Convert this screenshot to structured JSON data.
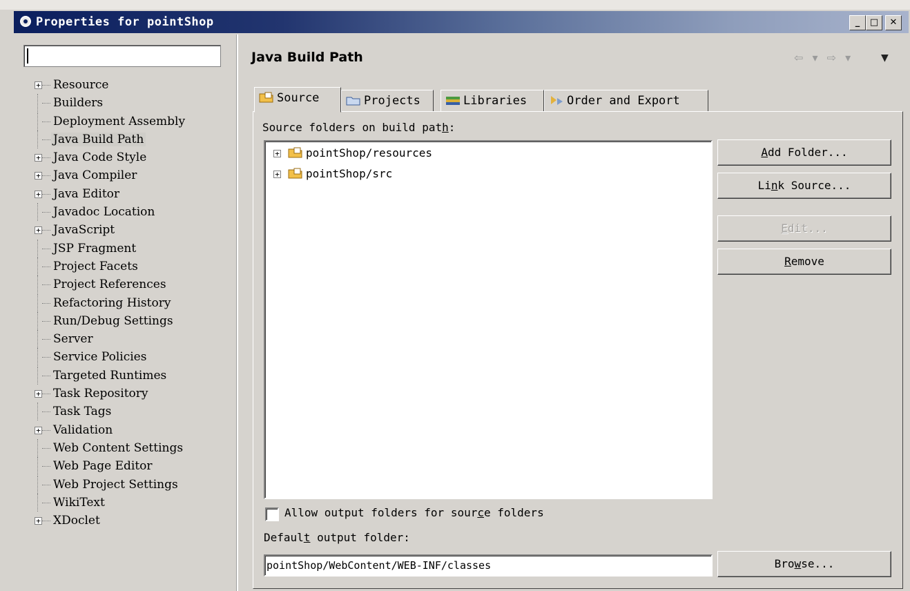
{
  "window": {
    "title": "Properties for pointShop",
    "minimize_label": "_",
    "maximize_label": "□",
    "close_label": "✕"
  },
  "filter": {
    "value": ""
  },
  "tree": [
    {
      "label": "Resource",
      "expandable": true
    },
    {
      "label": "Builders",
      "expandable": false
    },
    {
      "label": "Deployment Assembly",
      "expandable": false
    },
    {
      "label": "Java Build Path",
      "expandable": false,
      "selected": true
    },
    {
      "label": "Java Code Style",
      "expandable": true
    },
    {
      "label": "Java Compiler",
      "expandable": true
    },
    {
      "label": "Java Editor",
      "expandable": true
    },
    {
      "label": "Javadoc Location",
      "expandable": false
    },
    {
      "label": "JavaScript",
      "expandable": true
    },
    {
      "label": "JSP Fragment",
      "expandable": false
    },
    {
      "label": "Project Facets",
      "expandable": false
    },
    {
      "label": "Project References",
      "expandable": false
    },
    {
      "label": "Refactoring History",
      "expandable": false
    },
    {
      "label": "Run/Debug Settings",
      "expandable": false
    },
    {
      "label": "Server",
      "expandable": false
    },
    {
      "label": "Service Policies",
      "expandable": false
    },
    {
      "label": "Targeted Runtimes",
      "expandable": false
    },
    {
      "label": "Task Repository",
      "expandable": true
    },
    {
      "label": "Task Tags",
      "expandable": false
    },
    {
      "label": "Validation",
      "expandable": true
    },
    {
      "label": "Web Content Settings",
      "expandable": false
    },
    {
      "label": "Web Page Editor",
      "expandable": false
    },
    {
      "label": "Web Project Settings",
      "expandable": false
    },
    {
      "label": "WikiText",
      "expandable": false
    },
    {
      "label": "XDoclet",
      "expandable": true
    }
  ],
  "page": {
    "title": "Java Build Path",
    "nav_back": "⇦ ▾",
    "nav_forward": "⇨ ▾",
    "menu": "▼"
  },
  "tabs": [
    {
      "label": "Source",
      "icon": "source-folder-icon",
      "active": true
    },
    {
      "label": "Projects",
      "icon": "projects-icon"
    },
    {
      "label": "Libraries",
      "icon": "libraries-icon"
    },
    {
      "label": "Order and Export",
      "icon": "order-export-icon"
    }
  ],
  "source": {
    "label_pre": "Source folders on build pat",
    "label_mnemonic": "h",
    "label_post": ":",
    "folders": [
      "pointShop/resources",
      "pointShop/src"
    ]
  },
  "buttons": {
    "add_folder": {
      "pre": "",
      "mn": "A",
      "post": "dd Folder..."
    },
    "link_source": {
      "pre": "Li",
      "mn": "n",
      "post": "k Source..."
    },
    "edit": {
      "pre": "",
      "mn": "E",
      "post": "dit..."
    },
    "remove": {
      "pre": "",
      "mn": "R",
      "post": "emove"
    },
    "browse": {
      "pre": "Bro",
      "mn": "w",
      "post": "se..."
    }
  },
  "allow_output": {
    "checked": false,
    "pre": "Allow output folders for sour",
    "mn": "c",
    "post": "e folders"
  },
  "output": {
    "label_pre": "Defaul",
    "label_mn": "t",
    "label_post": " output folder:",
    "value": "pointShop/WebContent/WEB-INF/classes"
  },
  "colors": {
    "title_gradient_start": "#0b1f5e",
    "title_gradient_end": "#a8b3cc",
    "dialog_bg": "#d6d3ce",
    "selection_bg": "#cfcdc8"
  }
}
